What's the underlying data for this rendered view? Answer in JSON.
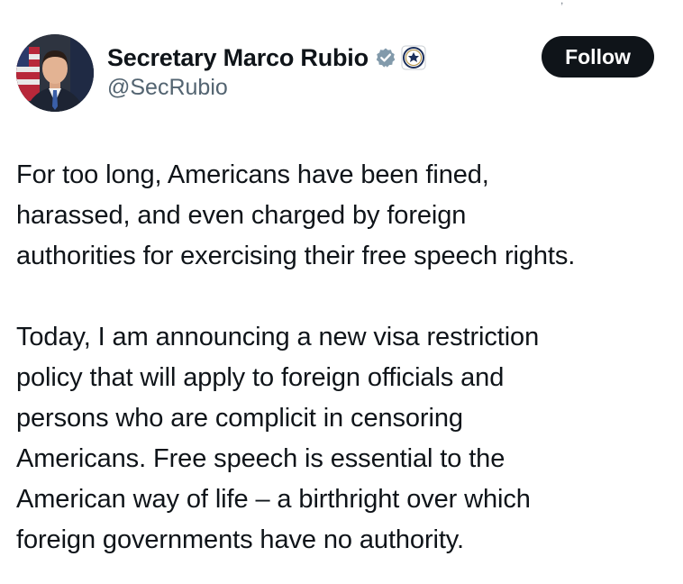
{
  "header": {
    "display_name": "Secretary Marco Rubio",
    "handle": "@SecRubio",
    "verified_icon": "verified-badge-icon",
    "affiliation_icon": "state-department-seal-icon",
    "follow_label": "Follow"
  },
  "tweet": {
    "paragraphs": [
      "For too long, Americans have been fined,\nharassed, and even charged by foreign\nauthorities for exercising their free speech rights.",
      "Today, I am announcing a new visa restriction\npolicy that will apply to foreign officials and\npersons who are complicit in censoring\nAmericans. Free speech is essential to the\nAmerican way of life – a birthright over which\nforeign governments have no authority."
    ]
  },
  "colors": {
    "text": "#0f1419",
    "secondary": "#536471",
    "button_bg": "#0f1419",
    "button_text": "#ffffff",
    "verified": "#829aab"
  }
}
